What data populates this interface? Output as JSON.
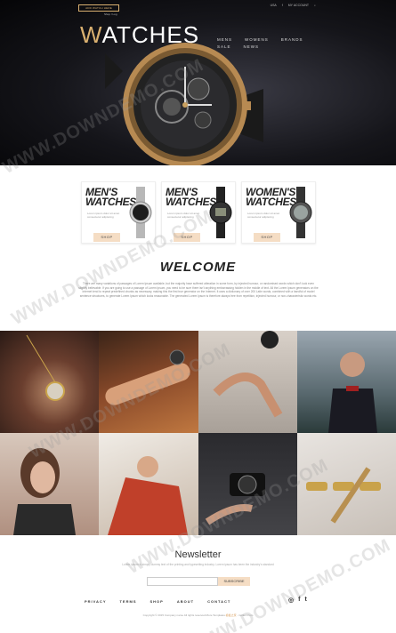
{
  "header": {
    "cart_button": "ADD WATCH HERE",
    "login": "Shop / Log",
    "brand_first": "W",
    "brand_rest": "ATCHES",
    "top_links": [
      "USA",
      "f",
      "MY ACCOUNT",
      "⌕"
    ],
    "nav": [
      "MENS",
      "WOMENS",
      "BRANDS",
      "SALE",
      "NEWS"
    ]
  },
  "cards": [
    {
      "title_line1": "MEN'S",
      "title_line2": "WATCHES",
      "desc": "Lorem ipsum dolor sit amet consectetur adipiscing",
      "button": "SHOP"
    },
    {
      "title_line1": "MEN'S",
      "title_line2": "WATCHES",
      "desc": "Lorem ipsum dolor sit amet consectetur adipiscing",
      "button": "SHOP"
    },
    {
      "title_line1": "WOMEN'S",
      "title_line2": "WATCHES",
      "desc": "Lorem ipsum dolor sit amet consectetur adipiscing",
      "button": "SHOP"
    }
  ],
  "welcome": {
    "title": "WELCOME",
    "text": "There are many variations of passages of Lorem Ipsum available, but the majority have suffered alteration in some form, by injected humour, or randomised words which don't look even slightly believable. If you are going to use a passage of Lorem Ipsum, you need to be sure there isn't anything embarrassing hidden in the middle of text. All the Lorem Ipsum generators on the Internet tend to repeat predefined chunks as necessary, making this the first true generator on the Internet. It uses a dictionary of over 200 Latin words, combined with a handful of model sentence structures, to generate Lorem Ipsum which looks reasonable. The generated Lorem Ipsum is therefore always free from repetition, injected humour, or non-characteristic words etc."
  },
  "newsletter": {
    "title": "Newsletter",
    "subtitle": "Lorem ipsum is simply dummy text of the printing and typesetting industry. Lorem ipsum has been the industry's standard",
    "placeholder": "",
    "button": "SUBSCRIBE"
  },
  "footer": {
    "nav": [
      "PRIVACY",
      "TERMS",
      "SHOP",
      "ABOUT",
      "CONTACT"
    ],
    "social": [
      "◎",
      "f",
      "t"
    ],
    "copyright": "Copyright © 2015 Company name All rights reserved.More Templates",
    "copyright_link": "模板之家",
    "copyright_tail": "- Collect from"
  },
  "watermark": "WWW.DOWNDEMO.COM",
  "colors": {
    "accent": "#d9b070",
    "button": "#f5ddc4",
    "dark": "#111111"
  }
}
